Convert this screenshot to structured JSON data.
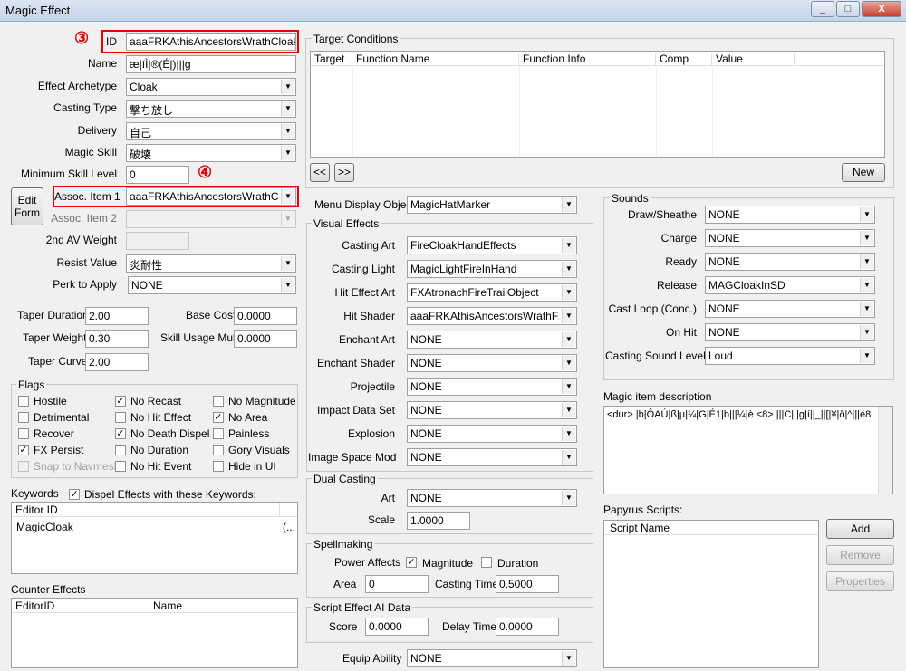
{
  "window": {
    "title": "Magic Effect",
    "min": "_",
    "max": "□",
    "close": "X"
  },
  "annotations": {
    "a3": "③",
    "a4": "④"
  },
  "left": {
    "id_label": "ID",
    "id_value": "aaaFRKAthisAncestorsWrathCloakFFS",
    "name_label": "Name",
    "name_value": "æ|íÌ|®(É|)|||g",
    "archetype_label": "Effect Archetype",
    "archetype_value": "Cloak",
    "casting_type_label": "Casting Type",
    "casting_type_value": "撃ち放し",
    "delivery_label": "Delivery",
    "delivery_value": "自己",
    "magic_skill_label": "Magic Skill",
    "magic_skill_value": "破壊",
    "min_skill_label": "Minimum Skill Level",
    "min_skill_value": "0",
    "edit_form": "Edit Form",
    "assoc1_label": "Assoc. Item 1",
    "assoc1_value": "aaaFRKAthisAncestorsWrathCloak",
    "assoc2_label": "Assoc. Item 2",
    "assoc2_value": "",
    "av_weight_label": "2nd AV Weight",
    "av_weight_value": "",
    "resist_label": "Resist Value",
    "resist_value": "炎耐性",
    "perk_label": "Perk to Apply",
    "perk_value": "NONE",
    "taper_duration_label": "Taper Duration",
    "taper_duration_value": "2.00",
    "base_cost_label": "Base Cost",
    "base_cost_value": "0.0000",
    "taper_weight_label": "Taper Weight",
    "taper_weight_value": "0.30",
    "skill_usage_label": "Skill Usage Mult",
    "skill_usage_value": "0.0000",
    "taper_curve_label": "Taper Curve",
    "taper_curve_value": "2.00"
  },
  "flags": {
    "title": "Flags",
    "items": [
      {
        "label": "Hostile",
        "checked": false,
        "disabled": false,
        "mark": ""
      },
      {
        "label": "No Recast",
        "checked": true,
        "disabled": false,
        "mark": "✓"
      },
      {
        "label": "No Magnitude",
        "checked": false,
        "disabled": false,
        "mark": ""
      },
      {
        "label": "Detrimental",
        "checked": false,
        "disabled": false,
        "mark": ""
      },
      {
        "label": "No Hit Effect",
        "checked": false,
        "disabled": false,
        "mark": ""
      },
      {
        "label": "No Area",
        "checked": true,
        "disabled": false,
        "mark": "✓"
      },
      {
        "label": "Recover",
        "checked": false,
        "disabled": false,
        "mark": ""
      },
      {
        "label": "No Death Dispel",
        "checked": true,
        "disabled": false,
        "mark": "✓"
      },
      {
        "label": "Painless",
        "checked": false,
        "disabled": false,
        "mark": ""
      },
      {
        "label": "FX Persist",
        "checked": true,
        "disabled": false,
        "mark": "✓"
      },
      {
        "label": "No Duration",
        "checked": false,
        "disabled": false,
        "mark": ""
      },
      {
        "label": "Gory Visuals",
        "checked": false,
        "disabled": false,
        "mark": ""
      },
      {
        "label": "Snap to Navmesh",
        "checked": false,
        "disabled": true,
        "mark": ""
      },
      {
        "label": "No Hit Event",
        "checked": false,
        "disabled": false,
        "mark": ""
      },
      {
        "label": "Hide in UI",
        "checked": false,
        "disabled": false,
        "mark": ""
      }
    ]
  },
  "keywords": {
    "label": "Keywords",
    "dispel_label": "Dispel Effects with these Keywords:",
    "dispel_mark": "✓",
    "col_editor": "Editor ID",
    "rows": [
      {
        "id": "MagicCloak",
        "more": "(..."
      }
    ]
  },
  "counter": {
    "label": "Counter Effects",
    "col1": "EditorID",
    "col2": "Name"
  },
  "target": {
    "title": "Target Conditions",
    "cols": [
      "Target",
      "Function Name",
      "Function Info",
      "Comp",
      "Value"
    ],
    "prev": "<<",
    "next": ">>",
    "new": "New"
  },
  "menu_display": {
    "label": "Menu Display Object",
    "value": "MagicHatMarker"
  },
  "visual": {
    "title": "Visual Effects",
    "rows": [
      {
        "label": "Casting Art",
        "value": "FireCloakHandEffects"
      },
      {
        "label": "Casting Light",
        "value": "MagicLightFireInHand"
      },
      {
        "label": "Hit Effect Art",
        "value": "FXAtronachFireTrailObject"
      },
      {
        "label": "Hit Shader",
        "value": "aaaFRKAthisAncestorsWrathFXSha"
      },
      {
        "label": "Enchant Art",
        "value": "NONE"
      },
      {
        "label": "Enchant Shader",
        "value": "NONE"
      },
      {
        "label": "Projectile",
        "value": "NONE"
      },
      {
        "label": "Impact Data Set",
        "value": "NONE"
      },
      {
        "label": "Explosion",
        "value": "NONE"
      },
      {
        "label": "Image Space Mod",
        "value": "NONE"
      }
    ]
  },
  "dual": {
    "title": "Dual Casting",
    "art_label": "Art",
    "art_value": "NONE",
    "scale_label": "Scale",
    "scale_value": "1.0000"
  },
  "spellmaking": {
    "title": "Spellmaking",
    "powers_label": "Power Affects",
    "magnitude_label": "Magnitude",
    "magnitude_mark": "✓",
    "duration_label": "Duration",
    "area_label": "Area",
    "area_value": "0",
    "casting_time_label": "Casting Time",
    "casting_time_value": "0.5000"
  },
  "ai": {
    "title": "Script Effect AI Data",
    "score_label": "Score",
    "score_value": "0.0000",
    "delay_label": "Delay Time",
    "delay_value": "0.0000"
  },
  "equip": {
    "label": "Equip Ability",
    "value": "NONE"
  },
  "sounds": {
    "title": "Sounds",
    "rows": [
      {
        "label": "Draw/Sheathe",
        "value": "NONE"
      },
      {
        "label": "Charge",
        "value": "NONE"
      },
      {
        "label": "Ready",
        "value": "NONE"
      },
      {
        "label": "Release",
        "value": "MAGCloakInSD"
      },
      {
        "label": "Cast Loop (Conc.)",
        "value": "NONE"
      },
      {
        "label": "On Hit",
        "value": "NONE"
      },
      {
        "label": "Casting Sound Level",
        "value": "Loud"
      }
    ]
  },
  "description": {
    "label": "Magic item description",
    "value": "<dur> |b|ÔAÚ|ß|µ|¼|G|É1|b|||¼|è <8> |||C|||g|í||_||[|¥|ð|^|||é8"
  },
  "papyrus": {
    "label": "Papyrus Scripts:",
    "col": "Script Name",
    "add": "Add",
    "remove": "Remove",
    "properties": "Properties"
  }
}
